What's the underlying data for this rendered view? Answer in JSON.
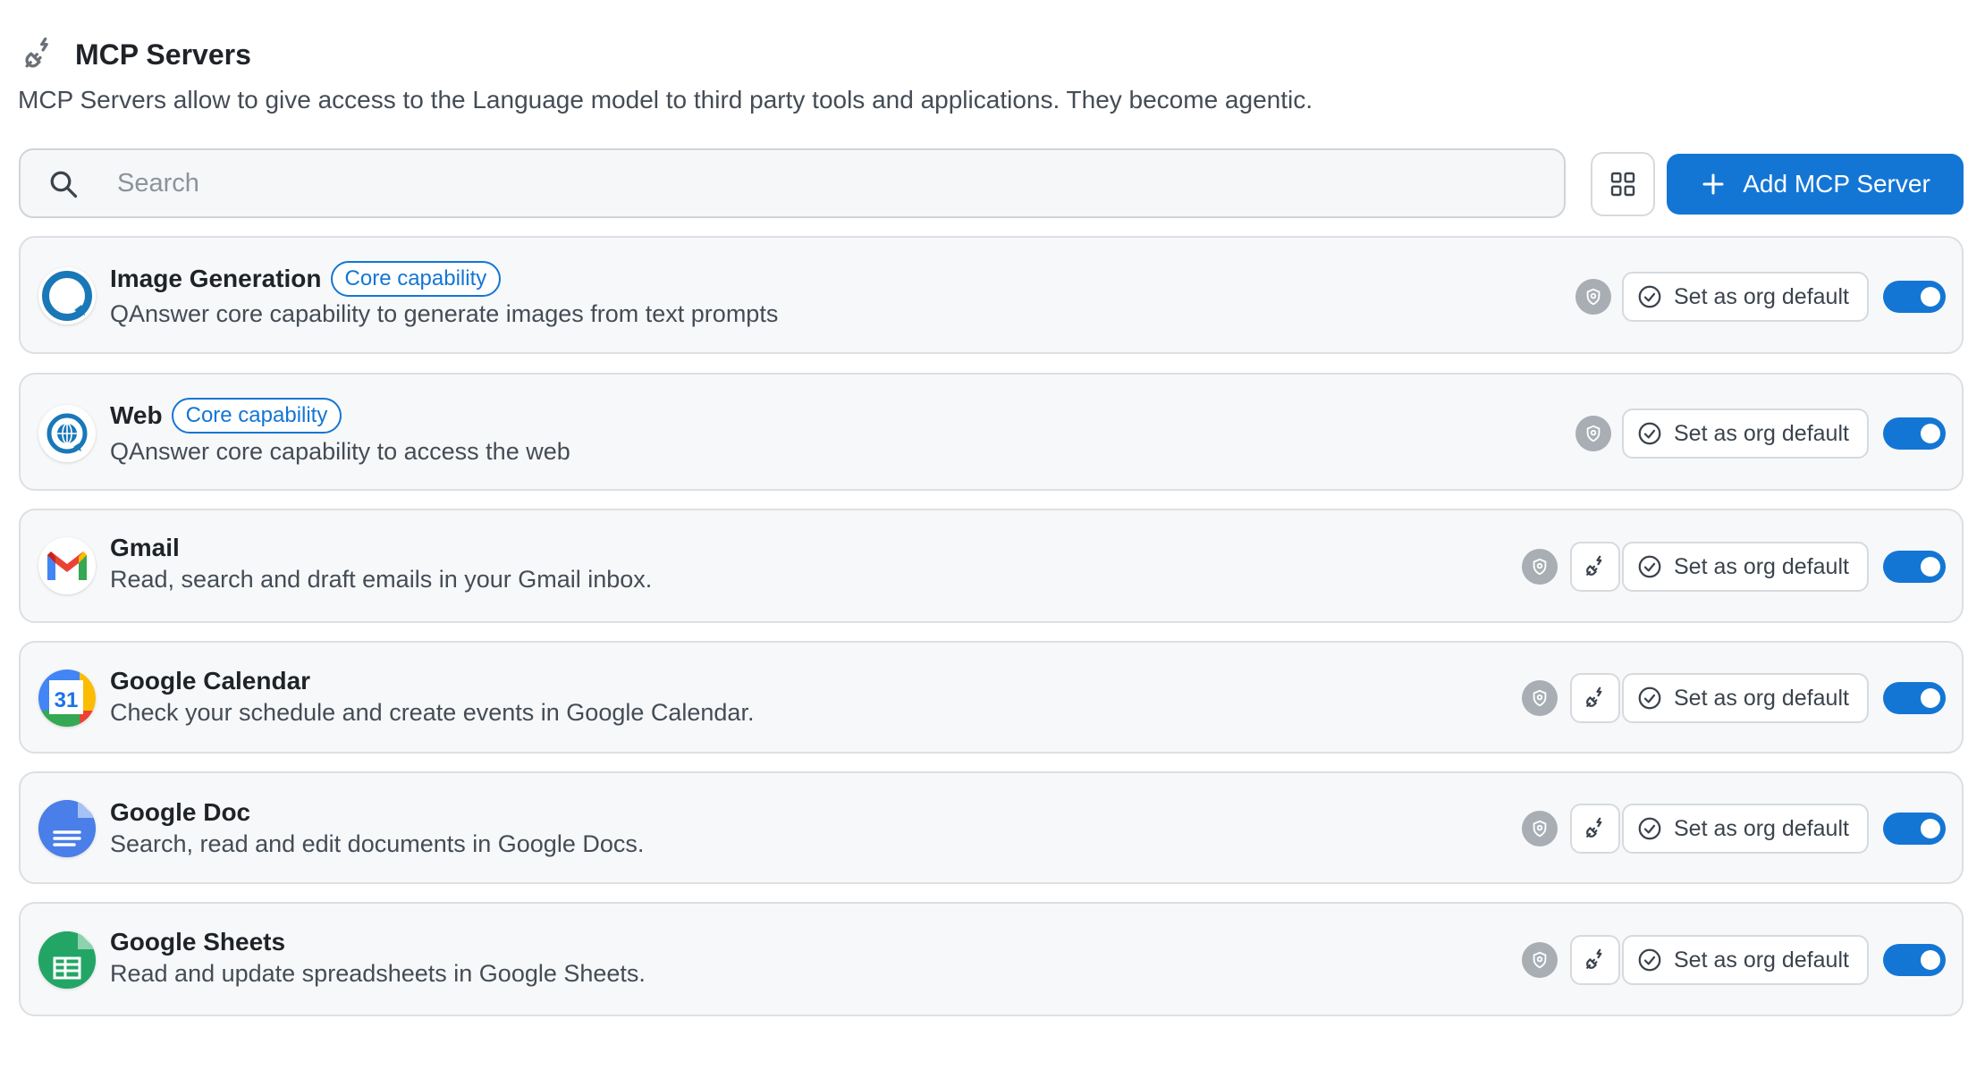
{
  "header": {
    "title": "MCP Servers",
    "description": "MCP Servers allow to give access to the Language model to third party tools and applications. They become agentic."
  },
  "search": {
    "placeholder": "Search",
    "value": ""
  },
  "toolbar": {
    "add_label": "Add MCP Server"
  },
  "colors": {
    "accent": "#1476d4",
    "shield": "#a8aeb4"
  },
  "servers": [
    {
      "name": "Image Generation",
      "badge": "Core capability",
      "description": "QAnswer core capability to generate images from text prompts",
      "default_label": "Set as org default",
      "enabled": true,
      "icon": "qanswer-logo"
    },
    {
      "name": "Web",
      "badge": "Core capability",
      "description": "QAnswer core capability to access the web",
      "default_label": "Set as org default",
      "enabled": true,
      "icon": "globe-icon"
    },
    {
      "name": "Gmail",
      "description": "Read, search and draft emails in your Gmail inbox.",
      "default_label": "Set as org default",
      "enabled": true,
      "icon": "gmail-logo"
    },
    {
      "name": "Google Calendar",
      "description": "Check your schedule and create events in Google Calendar.",
      "default_label": "Set as org default",
      "enabled": true,
      "icon": "google-calendar-logo",
      "icon_text": "31"
    },
    {
      "name": "Google Doc",
      "description": "Search, read and edit documents in Google Docs.",
      "default_label": "Set as org default",
      "enabled": true,
      "icon": "google-docs-logo"
    },
    {
      "name": "Google Sheets",
      "description": "Read and update spreadsheets in Google Sheets.",
      "default_label": "Set as org default",
      "enabled": true,
      "icon": "google-sheets-logo"
    }
  ]
}
